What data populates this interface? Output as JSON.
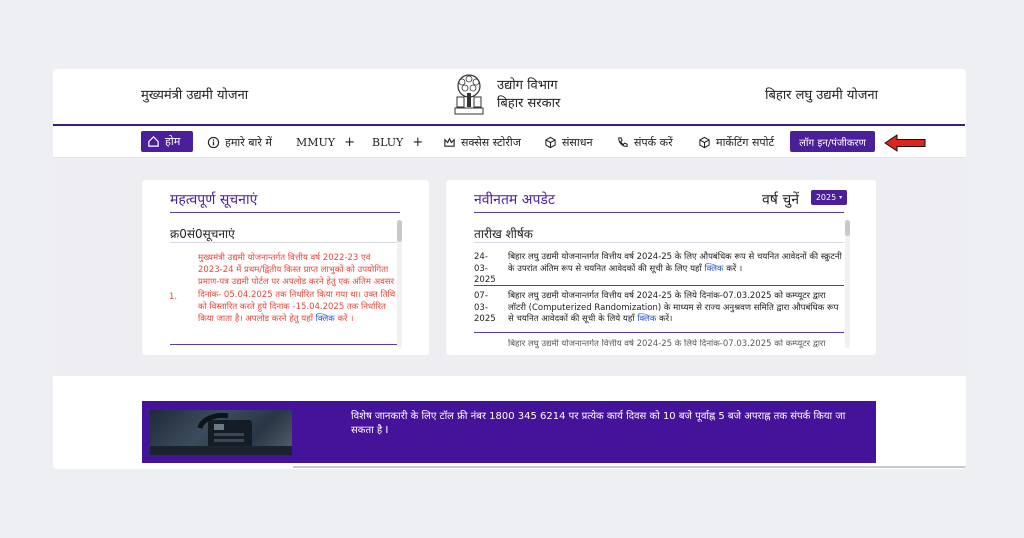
{
  "header": {
    "left_title": "मुख्यमंत्री उद्यमी योजना",
    "dept_line1": "उद्योग विभाग",
    "dept_line2": "बिहार सरकार",
    "right_title": "बिहार लघु उद्यमी योजना",
    "logo_icon": "bodhi-tree-emblem-icon"
  },
  "nav": {
    "home": "होम",
    "about": "हमारे बारे में",
    "mmuy": "MMUY",
    "bluy": "BLUY",
    "plus": "+",
    "success": "सक्सेस स्टोरीज",
    "resources": "संसाधन",
    "contact": "संपर्क करें",
    "marketing": "मार्केटिंग सपोर्ट",
    "login": "लॉग इन/पंजीकरण"
  },
  "important": {
    "title": "महत्वपूर्ण सूचनाएं",
    "col_header": "क्र0सं0सूचनाएं",
    "items": [
      {
        "sn": "1.",
        "text": "मुख्यमंत्री उद्यमी योजनान्तर्गत वित्तीय वर्ष 2022-23 एवं 2023-24 में प्रथम/द्वितीय किस्त प्राप्त लाभुकों को उपयोगिता प्रमाण-पत्र उद्यमी पोर्टल पर अपलोड करने हेतु एक अंतिम अवसर दिनांक- 05.04.2025 तक निर्धारित किया गया था। उक्त तिथि को विस्तारित करते हुये दिनांक -15.04.2025 तक निर्धारित किया जाता है। अपलोड करने हेतु यहाँ",
        "link": "क्लिक",
        "tail": "करें ।"
      }
    ]
  },
  "updates": {
    "title": "नवीनतम अपडेट",
    "year_label": "वर्ष चुनें",
    "year_value": "2025",
    "col_header": "तारीख शीर्षक",
    "rows": [
      {
        "date": "24-03-2025",
        "text": "बिहार लघु उद्यमी योजनान्तर्गत वित्तीय वर्ष 2024-25 के लिए औपबंधिक रूप से चयनित आवेदनों की स्क्रुटनी के उपरांत अंतिम रूप से चयनित आवेदकों की सूची के लिए यहाँ",
        "link": "क्लिक",
        "tail": "करें ।"
      },
      {
        "date": "07-03-2025",
        "text": "बिहार लघु उद्यमी योजनान्तर्गत वित्तीय वर्ष 2024-25 के लिये दिनांक-07.03.2025 को कम्प्यूटर द्वारा लॉटरी (Computerized Randomization) के माध्यम से राज्य अनुश्रवण समिति द्वारा औपबंधिक रूप से चयनित आवेदकों की सूची के लिये यहाँ",
        "link": "क्लिक",
        "tail": "करें।"
      },
      {
        "date": "",
        "text": "बिहार लघु उद्यमी योजनान्तर्गत वित्तीय वर्ष 2024-25 के लिये दिनांक-07.03.2025 को कम्प्यूटर द्वारा",
        "link": "",
        "tail": ""
      }
    ]
  },
  "banner": {
    "text": "विशेष जानकारी के लिए टॉल फ्री नंबर 1800 345 6214 पर प्रत्येक कार्य दिवस को 10 बजे पूर्वाह्न 5 बजे अपराह्न तक संपर्क किया जा सकता है I"
  },
  "colors": {
    "brand_purple": "#4b1f9a",
    "notice_red": "#e5483b",
    "link_blue": "#2a55c7",
    "annotation_arrow": "#e0241b"
  }
}
